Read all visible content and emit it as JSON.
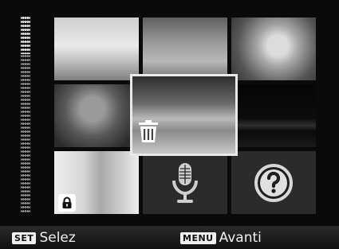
{
  "footer": {
    "set": {
      "key": "SET",
      "label": "Selez"
    },
    "menu": {
      "key": "MENU",
      "label": "Avanti"
    }
  },
  "icons": {
    "delete": "trash-icon",
    "lock": "lock-icon",
    "voice_memo": "microphone-icon",
    "help": "question-icon"
  },
  "colors": {
    "background": "#0a0a0a",
    "selected_border": "#e9e9e9",
    "footer_text": "#f0f0f0"
  }
}
